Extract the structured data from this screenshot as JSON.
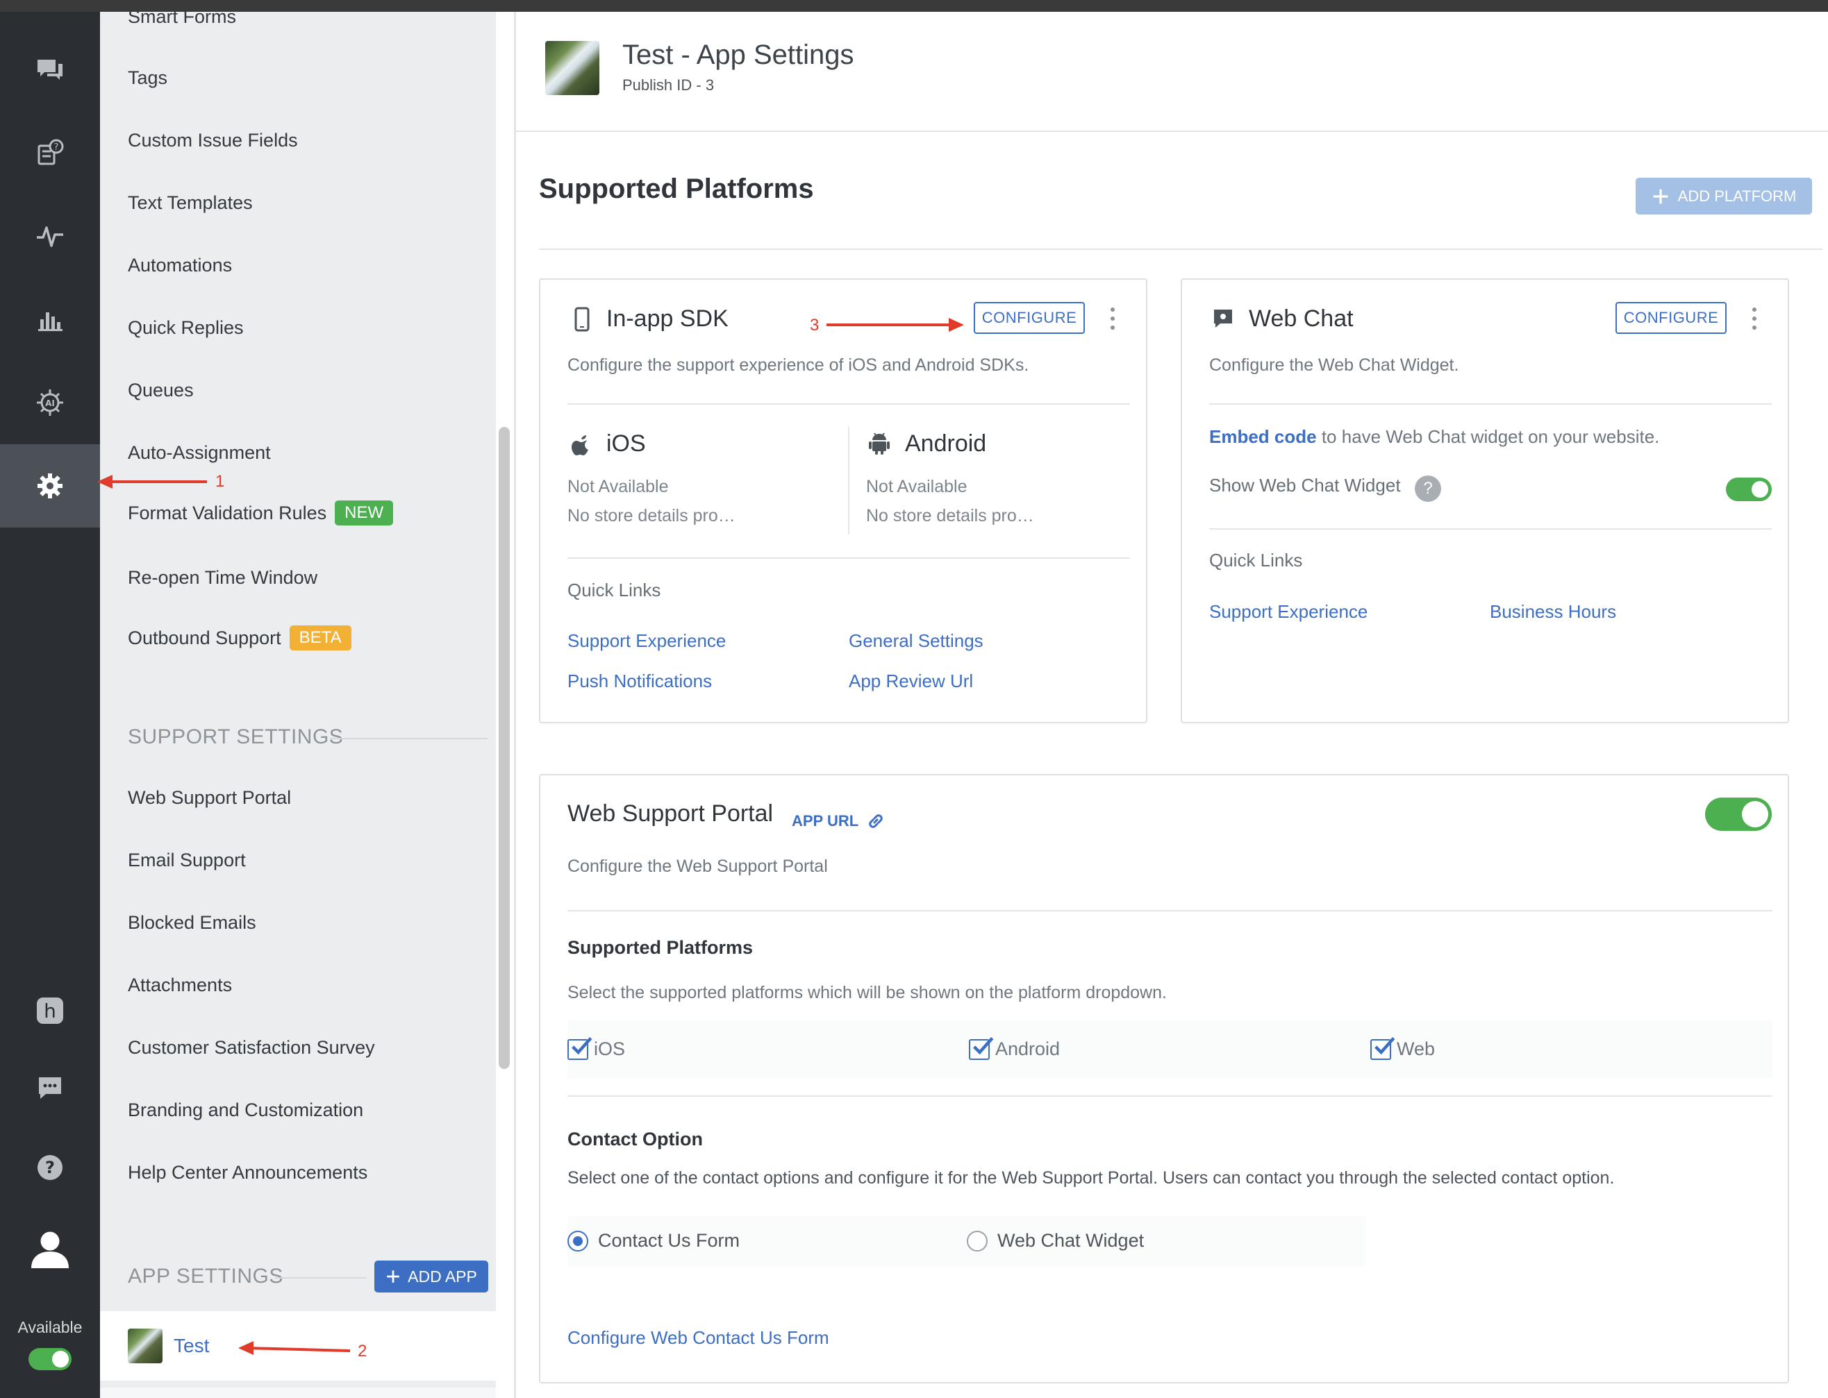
{
  "app_header": {
    "title": "Test - App Settings",
    "subtitle": "Publish ID - 3"
  },
  "rail": {
    "items": [
      {
        "icon": "chat-bubbles-icon"
      },
      {
        "icon": "faq-icon"
      },
      {
        "icon": "pulse-icon"
      },
      {
        "icon": "bar-chart-icon"
      },
      {
        "icon": "ai-icon"
      },
      {
        "icon": "gear-icon",
        "active": true
      },
      {
        "icon": "helpshift-h-icon"
      },
      {
        "icon": "message-icon"
      },
      {
        "icon": "help-icon"
      },
      {
        "icon": "user-avatar-icon"
      }
    ],
    "status_label": "Available"
  },
  "sidebar": {
    "partial_top_item": "Smart Forms",
    "items": [
      {
        "label": "Tags"
      },
      {
        "label": "Custom Issue Fields"
      },
      {
        "label": "Text Templates"
      },
      {
        "label": "Automations"
      },
      {
        "label": "Quick Replies"
      },
      {
        "label": "Queues"
      },
      {
        "label": "Auto-Assignment"
      },
      {
        "label": "Format Validation Rules",
        "badge": "NEW"
      },
      {
        "label": "Re-open Time Window"
      },
      {
        "label": "Outbound Support",
        "badge": "BETA"
      }
    ],
    "support_settings_heading": "SUPPORT SETTINGS",
    "support_items": [
      {
        "label": "Web Support Portal"
      },
      {
        "label": "Email Support"
      },
      {
        "label": "Blocked Emails"
      },
      {
        "label": "Attachments"
      },
      {
        "label": "Customer Satisfaction Survey"
      },
      {
        "label": "Branding and Customization"
      },
      {
        "label": "Help Center Announcements"
      }
    ],
    "app_settings_heading": "APP SETTINGS",
    "add_app_label": "ADD APP",
    "apps": [
      {
        "name": "Test"
      }
    ]
  },
  "main": {
    "page_title": "Supported Platforms",
    "add_platform_label": "ADD PLATFORM",
    "inapp_card": {
      "title": "In-app SDK",
      "configure_label": "CONFIGURE",
      "description": "Configure the support experience of iOS and Android SDKs.",
      "ios": {
        "name": "iOS",
        "status": "Not Available",
        "store": "No store details pro…"
      },
      "android": {
        "name": "Android",
        "status": "Not Available",
        "store": "No store details pro…"
      },
      "quick_links_label": "Quick Links",
      "links": [
        "Support Experience",
        "General Settings",
        "Push Notifications",
        "App Review Url"
      ]
    },
    "webchat_card": {
      "title": "Web Chat",
      "configure_label": "CONFIGURE",
      "description": "Configure the Web Chat Widget.",
      "embed_link": "Embed code",
      "embed_text": "to have Web Chat widget on your website.",
      "show_widget_label": "Show Web Chat Widget",
      "show_widget_on": true,
      "help_glyph": "?",
      "quick_links_label": "Quick Links",
      "links": [
        "Support Experience",
        "Business Hours"
      ]
    },
    "portal_card": {
      "title": "Web Support Portal",
      "app_url_label": "APP URL",
      "enabled": true,
      "description": "Configure the Web Support Portal",
      "platforms_label": "Supported Platforms",
      "platforms_desc": "Select the supported platforms which will be shown on the platform dropdown.",
      "platforms": [
        {
          "label": "iOS",
          "checked": true
        },
        {
          "label": "Android",
          "checked": true
        },
        {
          "label": "Web",
          "checked": true
        }
      ],
      "contact_label": "Contact Option",
      "contact_desc": "Select one of the contact options and configure it for the Web Support Portal. Users can contact you through the selected contact option.",
      "contact_options": [
        {
          "label": "Contact Us Form",
          "selected": true
        },
        {
          "label": "Web Chat Widget",
          "selected": false
        }
      ],
      "configure_link": "Configure Web Contact Us Form"
    }
  },
  "annotations": [
    "1",
    "2",
    "3"
  ],
  "colors": {
    "accent": "#3c6fc4",
    "toggle_on": "#4caf50",
    "badge_new": "#4caf50",
    "badge_beta": "#f2b135",
    "annotation": "#e03b2b",
    "rail_bg": "#2b2f33"
  }
}
